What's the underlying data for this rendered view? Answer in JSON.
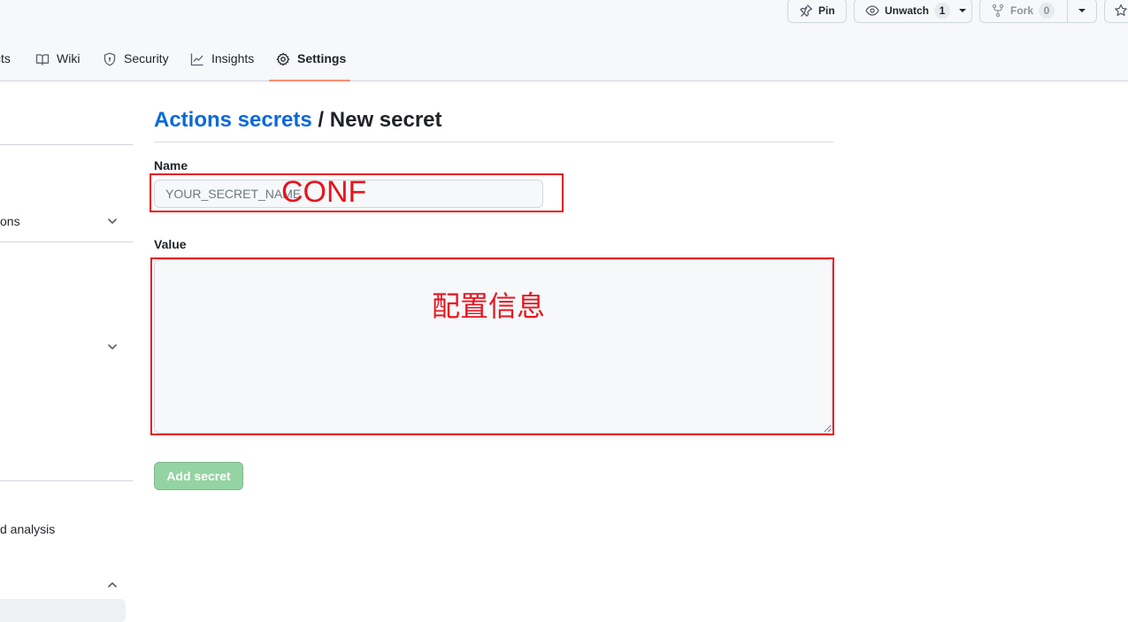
{
  "repo_actions": {
    "pin_label": "Pin",
    "watch_label": "Unwatch",
    "watch_count": "1",
    "fork_label": "Fork",
    "fork_count": "0"
  },
  "tabs": [
    {
      "label": "cts"
    },
    {
      "label": "Wiki"
    },
    {
      "label": "Security"
    },
    {
      "label": "Insights"
    },
    {
      "label": "Settings",
      "selected": true
    }
  ],
  "sidebar": {
    "items": [
      {
        "label": "ons",
        "chevron": "chevron-down"
      },
      {
        "label": "",
        "chevron": "chevron-down"
      },
      {
        "label": "d analysis"
      },
      {
        "label": "",
        "chevron": "chevron-up"
      }
    ]
  },
  "page": {
    "breadcrumb_link": "Actions secrets",
    "separator": "/",
    "current": "New secret"
  },
  "form": {
    "name_label": "Name",
    "name_placeholder": "YOUR_SECRET_NAME",
    "value_label": "Value",
    "submit_label": "Add secret"
  },
  "annotations": {
    "name_note": "CONF",
    "value_note": "配置信息",
    "color": "#e8141e"
  },
  "colors": {
    "link": "#0969da",
    "selected_tab_underline": "#fd8c73",
    "disabled_button": "#94d3a2"
  }
}
